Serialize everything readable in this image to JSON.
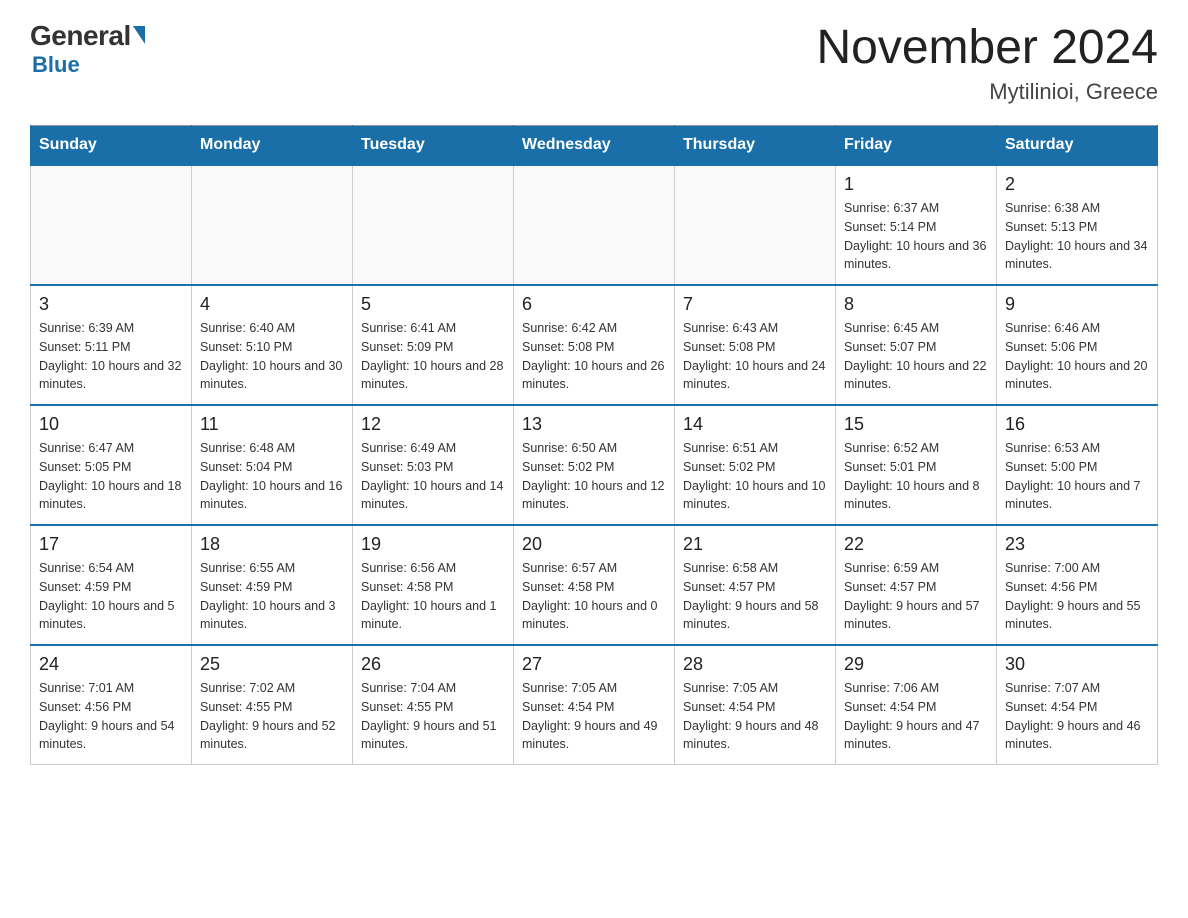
{
  "logo": {
    "text_general": "General",
    "text_blue": "Blue"
  },
  "header": {
    "title": "November 2024",
    "subtitle": "Mytilinioi, Greece"
  },
  "weekdays": [
    "Sunday",
    "Monday",
    "Tuesday",
    "Wednesday",
    "Thursday",
    "Friday",
    "Saturday"
  ],
  "weeks": [
    [
      {
        "day": "",
        "info": ""
      },
      {
        "day": "",
        "info": ""
      },
      {
        "day": "",
        "info": ""
      },
      {
        "day": "",
        "info": ""
      },
      {
        "day": "",
        "info": ""
      },
      {
        "day": "1",
        "info": "Sunrise: 6:37 AM\nSunset: 5:14 PM\nDaylight: 10 hours and 36 minutes."
      },
      {
        "day": "2",
        "info": "Sunrise: 6:38 AM\nSunset: 5:13 PM\nDaylight: 10 hours and 34 minutes."
      }
    ],
    [
      {
        "day": "3",
        "info": "Sunrise: 6:39 AM\nSunset: 5:11 PM\nDaylight: 10 hours and 32 minutes."
      },
      {
        "day": "4",
        "info": "Sunrise: 6:40 AM\nSunset: 5:10 PM\nDaylight: 10 hours and 30 minutes."
      },
      {
        "day": "5",
        "info": "Sunrise: 6:41 AM\nSunset: 5:09 PM\nDaylight: 10 hours and 28 minutes."
      },
      {
        "day": "6",
        "info": "Sunrise: 6:42 AM\nSunset: 5:08 PM\nDaylight: 10 hours and 26 minutes."
      },
      {
        "day": "7",
        "info": "Sunrise: 6:43 AM\nSunset: 5:08 PM\nDaylight: 10 hours and 24 minutes."
      },
      {
        "day": "8",
        "info": "Sunrise: 6:45 AM\nSunset: 5:07 PM\nDaylight: 10 hours and 22 minutes."
      },
      {
        "day": "9",
        "info": "Sunrise: 6:46 AM\nSunset: 5:06 PM\nDaylight: 10 hours and 20 minutes."
      }
    ],
    [
      {
        "day": "10",
        "info": "Sunrise: 6:47 AM\nSunset: 5:05 PM\nDaylight: 10 hours and 18 minutes."
      },
      {
        "day": "11",
        "info": "Sunrise: 6:48 AM\nSunset: 5:04 PM\nDaylight: 10 hours and 16 minutes."
      },
      {
        "day": "12",
        "info": "Sunrise: 6:49 AM\nSunset: 5:03 PM\nDaylight: 10 hours and 14 minutes."
      },
      {
        "day": "13",
        "info": "Sunrise: 6:50 AM\nSunset: 5:02 PM\nDaylight: 10 hours and 12 minutes."
      },
      {
        "day": "14",
        "info": "Sunrise: 6:51 AM\nSunset: 5:02 PM\nDaylight: 10 hours and 10 minutes."
      },
      {
        "day": "15",
        "info": "Sunrise: 6:52 AM\nSunset: 5:01 PM\nDaylight: 10 hours and 8 minutes."
      },
      {
        "day": "16",
        "info": "Sunrise: 6:53 AM\nSunset: 5:00 PM\nDaylight: 10 hours and 7 minutes."
      }
    ],
    [
      {
        "day": "17",
        "info": "Sunrise: 6:54 AM\nSunset: 4:59 PM\nDaylight: 10 hours and 5 minutes."
      },
      {
        "day": "18",
        "info": "Sunrise: 6:55 AM\nSunset: 4:59 PM\nDaylight: 10 hours and 3 minutes."
      },
      {
        "day": "19",
        "info": "Sunrise: 6:56 AM\nSunset: 4:58 PM\nDaylight: 10 hours and 1 minute."
      },
      {
        "day": "20",
        "info": "Sunrise: 6:57 AM\nSunset: 4:58 PM\nDaylight: 10 hours and 0 minutes."
      },
      {
        "day": "21",
        "info": "Sunrise: 6:58 AM\nSunset: 4:57 PM\nDaylight: 9 hours and 58 minutes."
      },
      {
        "day": "22",
        "info": "Sunrise: 6:59 AM\nSunset: 4:57 PM\nDaylight: 9 hours and 57 minutes."
      },
      {
        "day": "23",
        "info": "Sunrise: 7:00 AM\nSunset: 4:56 PM\nDaylight: 9 hours and 55 minutes."
      }
    ],
    [
      {
        "day": "24",
        "info": "Sunrise: 7:01 AM\nSunset: 4:56 PM\nDaylight: 9 hours and 54 minutes."
      },
      {
        "day": "25",
        "info": "Sunrise: 7:02 AM\nSunset: 4:55 PM\nDaylight: 9 hours and 52 minutes."
      },
      {
        "day": "26",
        "info": "Sunrise: 7:04 AM\nSunset: 4:55 PM\nDaylight: 9 hours and 51 minutes."
      },
      {
        "day": "27",
        "info": "Sunrise: 7:05 AM\nSunset: 4:54 PM\nDaylight: 9 hours and 49 minutes."
      },
      {
        "day": "28",
        "info": "Sunrise: 7:05 AM\nSunset: 4:54 PM\nDaylight: 9 hours and 48 minutes."
      },
      {
        "day": "29",
        "info": "Sunrise: 7:06 AM\nSunset: 4:54 PM\nDaylight: 9 hours and 47 minutes."
      },
      {
        "day": "30",
        "info": "Sunrise: 7:07 AM\nSunset: 4:54 PM\nDaylight: 9 hours and 46 minutes."
      }
    ]
  ]
}
